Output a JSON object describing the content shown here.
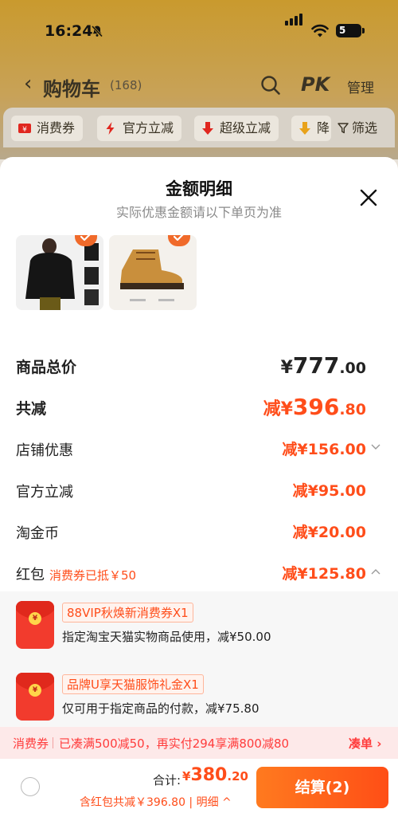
{
  "status_bar": {
    "time": "16:24",
    "battery": "5"
  },
  "nav": {
    "back": "‹",
    "title": "购物车",
    "count": "(168)",
    "pk": "PK",
    "manage": "管理"
  },
  "filters": [
    {
      "label": "消费券"
    },
    {
      "label": "官方立减"
    },
    {
      "label": "超级立减"
    },
    {
      "label": "降"
    }
  ],
  "filter_button": "筛选",
  "sheet": {
    "title": "金额明细",
    "subtitle": "实际优惠金额请以下单页为准",
    "rows": {
      "total": {
        "label": "商品总价",
        "currency": "¥",
        "int": "777",
        "dec": ".00"
      },
      "reduce": {
        "label": "共减",
        "prefix": "减¥",
        "int": "396",
        "dec": ".80"
      },
      "store": {
        "label": "店铺优惠",
        "prefix": "减¥",
        "int": "156",
        "dec": ".00"
      },
      "official": {
        "label": "官方立减",
        "prefix": "减¥",
        "int": "95",
        "dec": ".00"
      },
      "coins": {
        "label": "淘金币",
        "prefix": "减¥",
        "int": "20",
        "dec": ".00"
      },
      "redpack": {
        "label": "红包",
        "note": "消费券已抵￥50",
        "prefix": "减¥",
        "int": "125",
        "dec": ".80"
      }
    },
    "redpacks": [
      {
        "tag": "88VIP秋焕新消费券X1",
        "desc": "指定淘宝天猫实物商品使用，减¥50.00",
        "coin": "¥"
      },
      {
        "tag": "品牌U享天猫服饰礼金X1",
        "desc": "仅可用于指定商品的付款，减¥75.80",
        "coin": "¥"
      }
    ],
    "promo": {
      "label": "消费券",
      "text": "已凑满500减50，再实付294享满800减80",
      "link": "凑单 ›"
    },
    "bottom": {
      "total_label": "合计:",
      "total_currency": "¥",
      "total_int": "380",
      "total_dec": ".20",
      "detail": "含红包共减￥396.80 | 明细 ^",
      "checkout": "结算(2)"
    }
  },
  "colors": {
    "accent": "#ff4d1a",
    "brand_gold": "#c99a2e"
  }
}
